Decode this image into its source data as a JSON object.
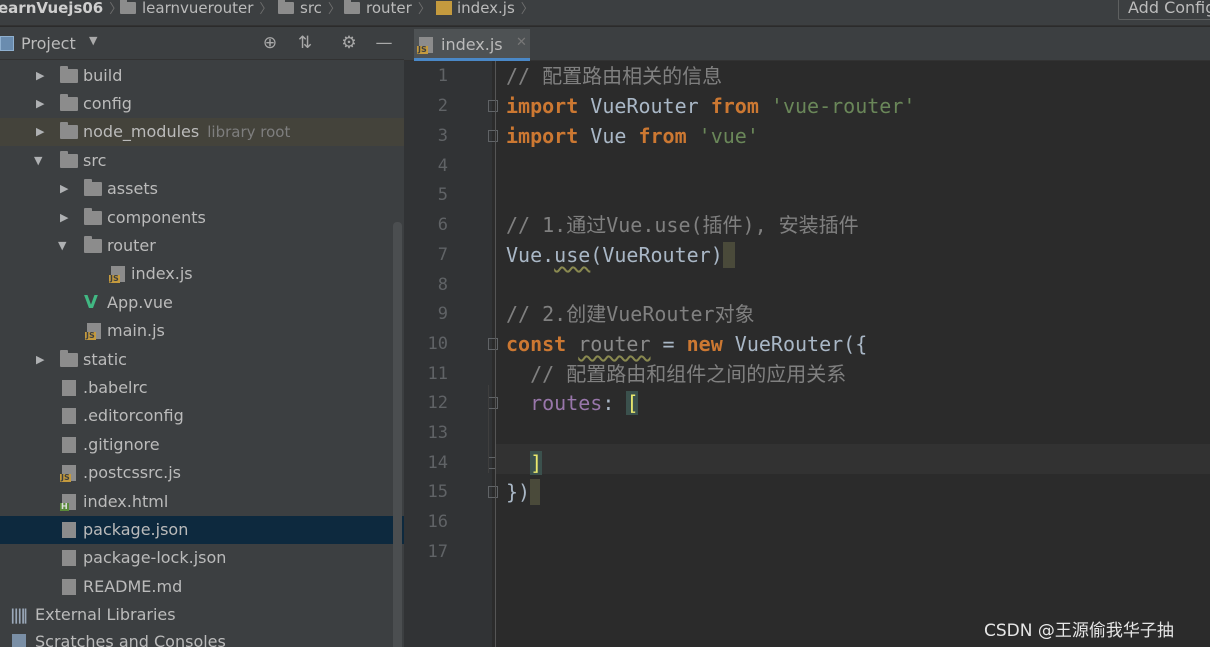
{
  "breadcrumb": {
    "items": [
      "earnVuejs06",
      "learnvuerouter",
      "src",
      "router",
      "index.js"
    ]
  },
  "toolbar": {
    "add_config_label": "Add Config"
  },
  "project_panel": {
    "title": "Project",
    "tree": [
      {
        "label": "build",
        "type": "folder",
        "expanded": false
      },
      {
        "label": "config",
        "type": "folder",
        "expanded": false
      },
      {
        "label": "node_modules",
        "hint": "library root",
        "type": "folder",
        "expanded": false
      },
      {
        "label": "src",
        "type": "folder",
        "expanded": true
      },
      {
        "label": "assets",
        "type": "folder",
        "expanded": false
      },
      {
        "label": "components",
        "type": "folder",
        "expanded": false
      },
      {
        "label": "router",
        "type": "folder",
        "expanded": true
      },
      {
        "label": "index.js",
        "type": "js"
      },
      {
        "label": "App.vue",
        "type": "vue"
      },
      {
        "label": "main.js",
        "type": "js"
      },
      {
        "label": "static",
        "type": "folder",
        "expanded": false
      },
      {
        "label": ".babelrc",
        "type": "file"
      },
      {
        "label": ".editorconfig",
        "type": "file"
      },
      {
        "label": ".gitignore",
        "type": "file"
      },
      {
        "label": ".postcssrc.js",
        "type": "js"
      },
      {
        "label": "index.html",
        "type": "html"
      },
      {
        "label": "package.json",
        "type": "file",
        "selected": true
      },
      {
        "label": "package-lock.json",
        "type": "file"
      },
      {
        "label": "README.md",
        "type": "file"
      },
      {
        "label": "External Libraries",
        "type": "lib"
      },
      {
        "label": "Scratches and Consoles",
        "type": "scratch"
      }
    ]
  },
  "editor": {
    "tab_label": "index.js",
    "line_numbers": [
      "1",
      "2",
      "3",
      "4",
      "5",
      "6",
      "7",
      "8",
      "9",
      "10",
      "11",
      "12",
      "13",
      "14",
      "15",
      "16",
      "17"
    ],
    "code": {
      "l1": "// 配置路由相关的信息",
      "l2_kw": "import",
      "l2_name": " VueRouter ",
      "l2_from": "from",
      "l2_str": " 'vue-router'",
      "l3_kw": "import",
      "l3_name": " Vue ",
      "l3_from": "from",
      "l3_str": " 'vue'",
      "l6": "// 1.通过Vue.use(插件), 安装插件",
      "l7_a": "Vue.",
      "l7_b": "use",
      "l7_c": "(VueRouter)",
      "l9": "// 2.创建VueRouter对象",
      "l10_kw": "const",
      "l10_sp": " ",
      "l10_var": "router",
      "l10_eq": " = ",
      "l10_new": "new",
      "l10_rest": " VueRouter({",
      "l11": "  // 配置路由和组件之间的应用关系",
      "l12_ind": "  ",
      "l12_prop": "routes",
      "l12_colon": ": ",
      "l12_brk": "[",
      "l14_ind": "  ",
      "l14_brk": "]",
      "l15": "})"
    }
  },
  "watermark": "CSDN @王源偷我华子抽",
  "colors": {
    "keyword": "#cc7832",
    "string": "#6a8759",
    "comment": "#808080",
    "property": "#9876aa",
    "selection": "#0d293e",
    "tab_underline": "#4a88c7"
  }
}
